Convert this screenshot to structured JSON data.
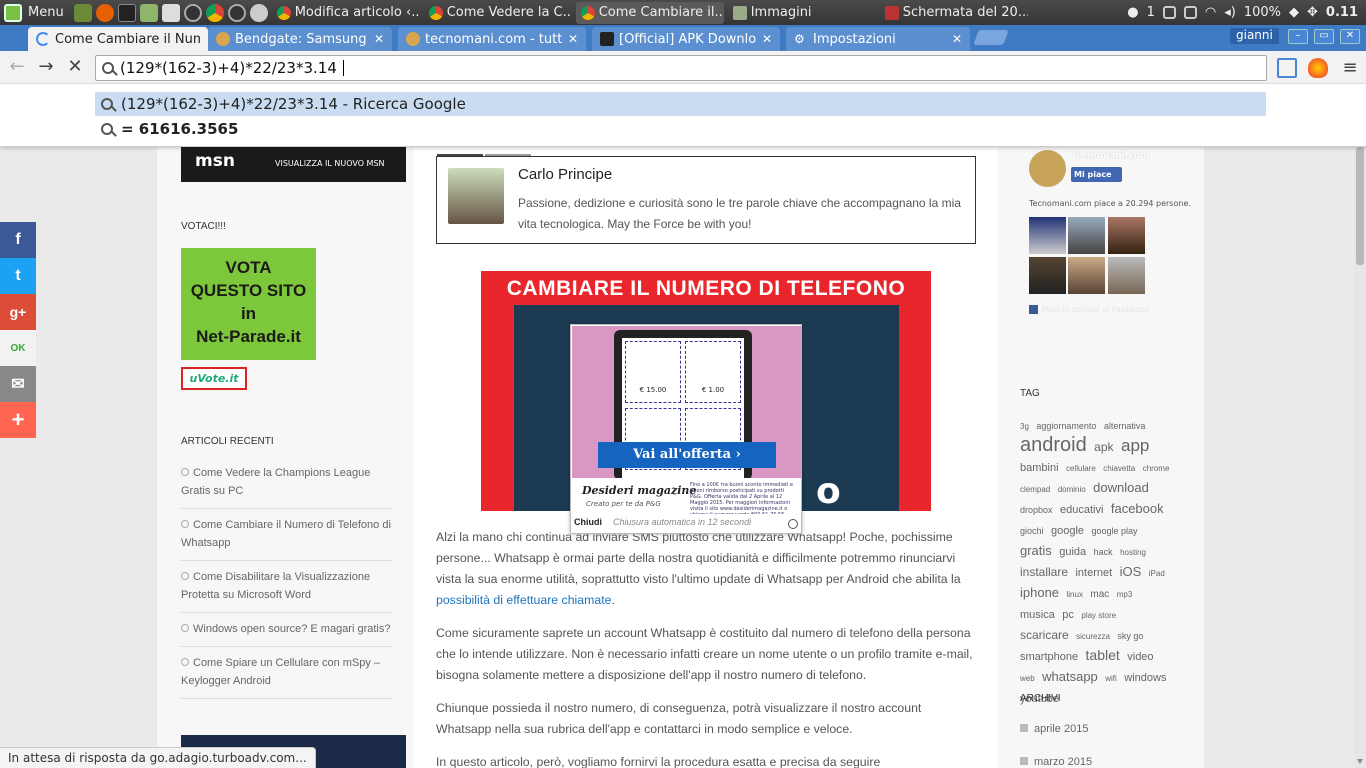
{
  "taskbar": {
    "menu_label": "Menu",
    "tasks": [
      {
        "label": "Modifica articolo ‹..."
      },
      {
        "label": "Come Vedere la C..."
      },
      {
        "label": "Come Cambiare il..."
      },
      {
        "label": "Immagini"
      },
      {
        "label": "Schermata del 20..."
      }
    ],
    "tray": {
      "notif_count": "1",
      "battery": "100%",
      "clock": "0.11"
    }
  },
  "browser": {
    "tabs": [
      {
        "label": "Come Cambiare il Num"
      },
      {
        "label": "Bendgate: Samsung G"
      },
      {
        "label": "tecnomani.com - tutti"
      },
      {
        "label": "[Official] APK Downloa"
      },
      {
        "label": "Impostazioni"
      }
    ],
    "user": "gianni",
    "omnibox": {
      "value": "(129*(162-3)+4)*22/23*3.14",
      "suggestions": [
        {
          "text": "(129*(162-3)+4)*22/23*3.14 - Ricerca Google"
        },
        {
          "text": "= 61616.3565"
        }
      ]
    },
    "status_text": "In attesa di risposta da go.adagio.turboadv.com..."
  },
  "sidebar_left": {
    "msn_banner": {
      "logo": "msn",
      "text": "VISUALIZZA IL NUOVO MSN"
    },
    "vote_heading": "VOTACI!!!",
    "vote_box": {
      "line1": "VOTA",
      "line2": "QUESTO SITO",
      "line3": "in",
      "line4": "Net-Parade.it"
    },
    "uvote_label": "uVote.it",
    "recent_heading": "ARTICOLI RECENTI",
    "recent": [
      "Come Vedere la Champions League Gratis su PC",
      "Come Cambiare il Numero di Telefono di Whatsapp",
      "Come Disabilitare la Visualizzazione Protetta su Microsoft Word",
      "Windows open source? E magari gratis?",
      "Come Spiare un Cellulare con mSpy – Keylogger Android"
    ]
  },
  "share_buttons": [
    {
      "icon": "facebook-icon",
      "glyph": "f",
      "color": "#3b5998"
    },
    {
      "icon": "twitter-icon",
      "glyph": "t",
      "color": "#1da1f2"
    },
    {
      "icon": "google-plus-icon",
      "glyph": "g+",
      "color": "#dd4b39"
    },
    {
      "icon": "oknotizie-icon",
      "glyph": "OK",
      "color": "#f2f2f2"
    },
    {
      "icon": "email-icon",
      "glyph": "✉",
      "color": "#888888"
    },
    {
      "icon": "more-icon",
      "glyph": "+",
      "color": "#ff6550"
    }
  ],
  "article": {
    "author": {
      "name": "Carlo Principe",
      "bio": "Passione, dedizione e curiosità sono le tre parole chiave che accompagnano la mia vita tecnologica. May the Force be with you!"
    },
    "hero_title": "CAMBIARE IL NUMERO DI TELEFONO",
    "paragraphs": [
      {
        "text": "Alzi la mano chi continua ad inviare SMS piuttosto che utilizzare Whatsapp! Poche, pochissime persone... Whatsapp è ormai parte della nostra quotidianità e difficilmente potremmo rinunciarvi vista la sua enorme utilità, soprattutto visto l'ultimo update di Whatsapp per Android che abilita la ",
        "link": "possibilità di effettuare chiamate",
        "tail": "."
      },
      {
        "text": "Come sicuramente saprete un account Whatsapp è costituito dal numero di telefono della persona che lo intende utilizzare. Non è necessario infatti creare un nome utente o un profilo tramite e-mail, bisogna solamente mettere a disposizione dell'app il nostro numero di telefono."
      },
      {
        "text": "Chiunque possieda il nostro numero, di conseguenza, potrà visualizzare il nostro account Whatsapp nella sua rubrica dell'app e contattarci in modo semplice e veloce."
      },
      {
        "text": "In questo articolo, però, vogliamo fornirvi la procedura esatta e precisa da seguire"
      }
    ]
  },
  "ad": {
    "coupon_values": [
      "€ 15.00",
      "€ 1.00",
      "€ 1.00",
      "€ 1.00"
    ],
    "cta": "Vai all'offerta",
    "brand": "Desideri magazine",
    "tagline": "Creato per te da P&G",
    "fine_print": "Fino a 100€ tra buoni sconto immediati e buoni rimborso posticipati su prodotti P&G. Offerta valida dal 2 Aprile al 12 Maggio 2015. Per maggiori informazioni visita il sito www.desiderimagazine.it o chiama il numero verde 800 51 76 55",
    "close": "Chiudi",
    "auto_close": "Chiusura automatica in 12 secondi"
  },
  "sidebar_right": {
    "fb": {
      "name": "Tecnomani.com",
      "like": "Mi piace",
      "count": "Tecnomani.com piace a 20.294 persone.",
      "plugin": "Plug-in sociale di Facebook"
    },
    "tag_heading": "TAG",
    "tags": [
      {
        "t": "3g",
        "s": 8
      },
      {
        "t": "aggiornamento",
        "s": 9
      },
      {
        "t": "alternativa",
        "s": 9
      },
      {
        "t": "android",
        "s": 20
      },
      {
        "t": "apk",
        "s": 12
      },
      {
        "t": "app",
        "s": 17
      },
      {
        "t": "bambini",
        "s": 11
      },
      {
        "t": "cellulare",
        "s": 8
      },
      {
        "t": "chiavetta",
        "s": 8
      },
      {
        "t": "chrome",
        "s": 8
      },
      {
        "t": "clempad",
        "s": 8
      },
      {
        "t": "dominio",
        "s": 8
      },
      {
        "t": "download",
        "s": 13
      },
      {
        "t": "dropbox",
        "s": 9
      },
      {
        "t": "educativi",
        "s": 11
      },
      {
        "t": "facebook",
        "s": 13
      },
      {
        "t": "giochi",
        "s": 9
      },
      {
        "t": "google",
        "s": 11
      },
      {
        "t": "google play",
        "s": 9
      },
      {
        "t": "gratis",
        "s": 13
      },
      {
        "t": "guida",
        "s": 11
      },
      {
        "t": "hack",
        "s": 9
      },
      {
        "t": "hosting",
        "s": 8
      },
      {
        "t": "installare",
        "s": 12
      },
      {
        "t": "internet",
        "s": 11
      },
      {
        "t": "iOS",
        "s": 13
      },
      {
        "t": "iPad",
        "s": 8
      },
      {
        "t": "iphone",
        "s": 13
      },
      {
        "t": "linux",
        "s": 8
      },
      {
        "t": "mac",
        "s": 10
      },
      {
        "t": "mp3",
        "s": 8
      },
      {
        "t": "musica",
        "s": 11
      },
      {
        "t": "pc",
        "s": 11
      },
      {
        "t": "play store",
        "s": 8
      },
      {
        "t": "scaricare",
        "s": 12
      },
      {
        "t": "sicurezza",
        "s": 8
      },
      {
        "t": "sky go",
        "s": 9
      },
      {
        "t": "smartphone",
        "s": 11
      },
      {
        "t": "tablet",
        "s": 14
      },
      {
        "t": "video",
        "s": 11
      },
      {
        "t": "web",
        "s": 8
      },
      {
        "t": "whatsapp",
        "s": 13
      },
      {
        "t": "wifi",
        "s": 8
      },
      {
        "t": "windows",
        "s": 11
      },
      {
        "t": "youtube",
        "s": 11
      }
    ],
    "archive_heading": "ARCHIVI",
    "archives": [
      "aprile 2015",
      "marzo 2015"
    ]
  }
}
